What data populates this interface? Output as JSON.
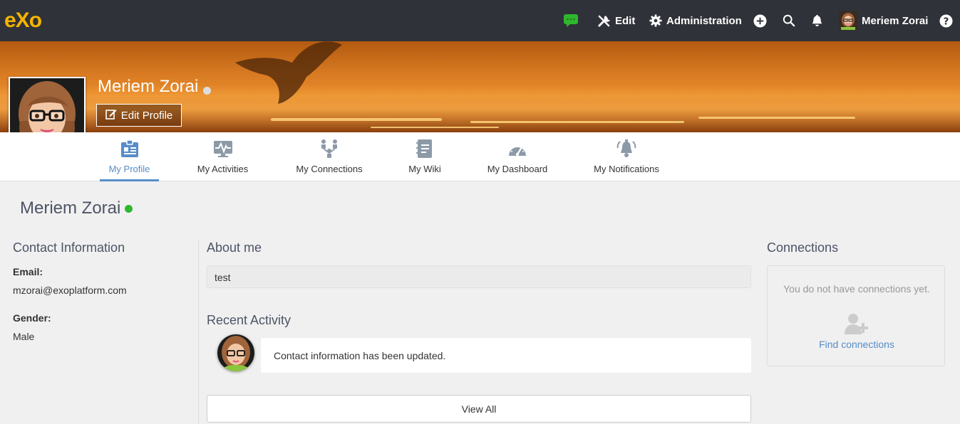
{
  "topbar": {
    "logo": "eXo",
    "edit_label": "Edit",
    "admin_label": "Administration",
    "user_name": "Meriem Zorai"
  },
  "banner": {
    "profile_name": "Meriem Zorai",
    "edit_profile_label": "Edit Profile"
  },
  "tabs": [
    {
      "label": "My Profile",
      "icon": "profile-card-icon",
      "active": true
    },
    {
      "label": "My Activities",
      "icon": "activity-pulse-icon",
      "active": false
    },
    {
      "label": "My Connections",
      "icon": "connections-icon",
      "active": false
    },
    {
      "label": "My Wiki",
      "icon": "wiki-icon",
      "active": false
    },
    {
      "label": "My Dashboard",
      "icon": "dashboard-gauge-icon",
      "active": false
    },
    {
      "label": "My Notifications",
      "icon": "notification-alarm-icon",
      "active": false
    }
  ],
  "profile": {
    "name": "Meriem Zorai",
    "contact_title": "Contact Information",
    "email_label": "Email:",
    "email_value": "mzorai@exoplatform.com",
    "gender_label": "Gender:",
    "gender_value": "Male",
    "about_title": "About me",
    "about_value": "test",
    "recent_title": "Recent Activity",
    "activity_text": "Contact information has been updated.",
    "view_all_label": "View All"
  },
  "connections": {
    "title": "Connections",
    "empty_text": "You do not have connections yet.",
    "find_label": "Find connections"
  },
  "colors": {
    "topbar": "#2f3238",
    "accent": "#578dc9",
    "online": "#2eb82e",
    "logo": "#f5b400"
  }
}
